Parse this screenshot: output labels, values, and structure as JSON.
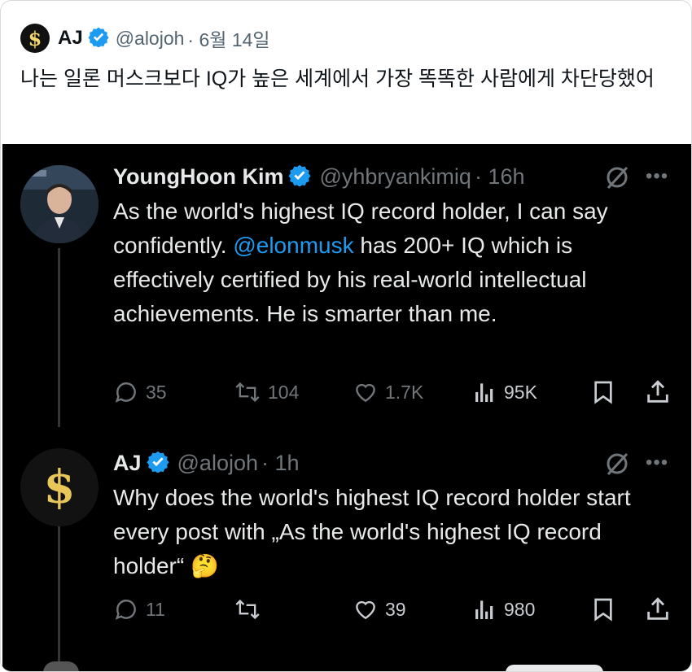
{
  "outer": {
    "avatar_glyph": "$",
    "name": "AJ",
    "handle": "@alojoh",
    "date": "· 6월 14일",
    "text": "나는 일론 머스크보다 IQ가 높은 세계에서 가장 똑똑한 사람에게 차단당했어"
  },
  "quoted": {
    "name": "YoungHoon Kim",
    "handle": "@yhbryankimiq",
    "time": "· 16h",
    "text_before": "As the world's highest IQ record holder, I can say confidently. ",
    "mention": "@elonmusk",
    "text_after": " has 200+ IQ which is effectively certified by his real-world intellectual achievements. He is smarter than me.",
    "replies": "35",
    "retweets": "104",
    "likes": "1.7K",
    "views": "95K"
  },
  "reply": {
    "avatar_glyph": "$",
    "name": "AJ",
    "handle": "@alojoh",
    "time": "· 1h",
    "text": "Why does the world's highest IQ record holder start every post with „As the world's highest IQ record holder“ 🤔",
    "replies": "11",
    "retweets": "",
    "likes": "39",
    "views": "980"
  },
  "colors": {
    "verified": "#1d9bf0",
    "dark_bg": "#000000",
    "muted": "#71767b",
    "link": "#1d9bf0"
  },
  "icons": [
    "verified-badge-icon",
    "grok-icon",
    "more-icon",
    "reply-icon",
    "retweet-icon",
    "like-icon",
    "views-icon",
    "bookmark-icon",
    "share-icon"
  ]
}
